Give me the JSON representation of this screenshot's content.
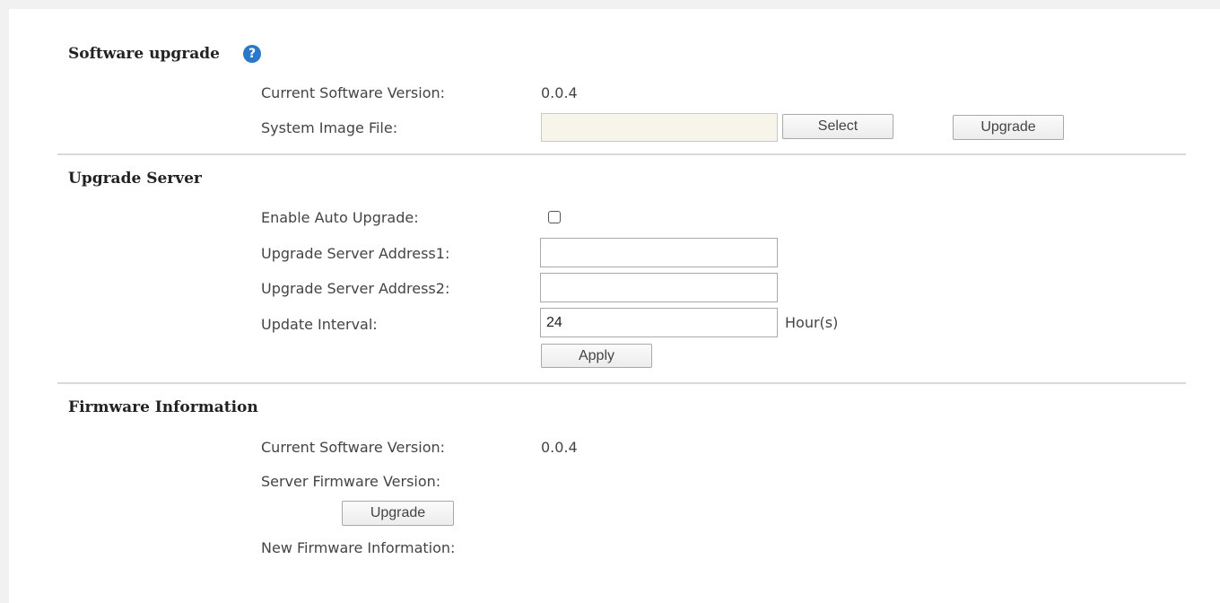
{
  "software_upgrade": {
    "title": "Software upgrade",
    "help_icon": "question-circle-icon",
    "current_version_label": "Current Software Version:",
    "current_version_value": "0.0.4",
    "image_file_label": "System Image File:",
    "image_file_value": "",
    "select_label": "Select",
    "upgrade_label": "Upgrade"
  },
  "upgrade_server": {
    "title": "Upgrade Server",
    "auto_upgrade_label": "Enable Auto Upgrade:",
    "auto_upgrade_checked": false,
    "address1_label": "Upgrade Server Address1:",
    "address1_value": "",
    "address2_label": "Upgrade Server Address2:",
    "address2_value": "",
    "interval_label": "Update Interval:",
    "interval_value": "24",
    "interval_unit": "Hour(s)",
    "apply_label": "Apply"
  },
  "firmware_info": {
    "title": "Firmware Information",
    "current_version_label": "Current Software Version:",
    "current_version_value": "0.0.4",
    "server_version_label": "Server Firmware Version:",
    "server_version_value": "",
    "upgrade_label": "Upgrade",
    "new_info_label": "New Firmware Information:",
    "new_info_value": ""
  },
  "colors": {
    "page_background": "#f1f1f1",
    "panel_background": "#ffffff",
    "help_icon": "#2b78c8",
    "file_input_background": "#f7f5ea"
  }
}
